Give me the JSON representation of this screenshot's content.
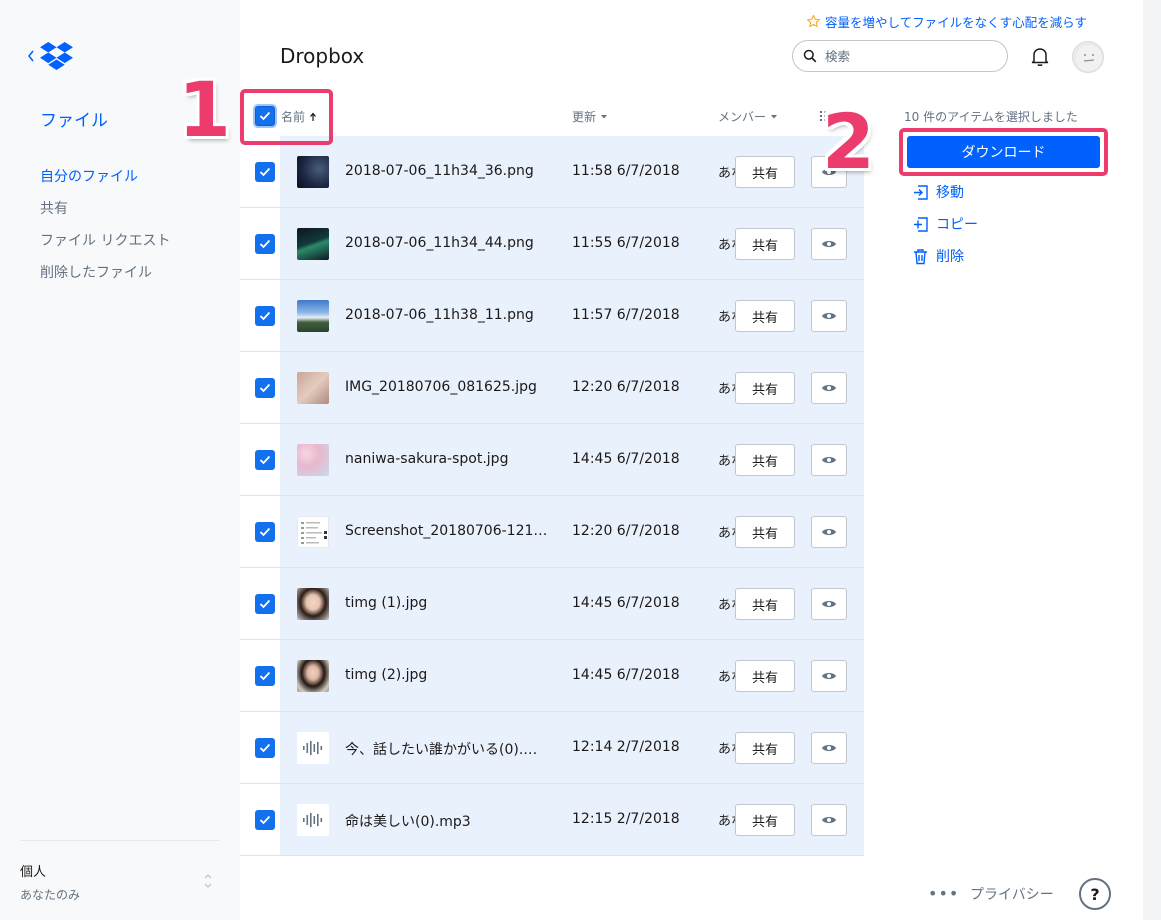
{
  "banner": {
    "upgrade_text": "容量を増やしてファイルをなくす心配を減らす"
  },
  "sidebar": {
    "section_title": "ファイル",
    "items": [
      {
        "label": "自分のファイル",
        "active": true
      },
      {
        "label": "共有",
        "active": false
      },
      {
        "label": "ファイル リクエスト",
        "active": false
      },
      {
        "label": "削除したファイル",
        "active": false
      }
    ],
    "account": {
      "type": "個人",
      "subtitle": "あなたのみ"
    }
  },
  "header": {
    "title": "Dropbox",
    "search_placeholder": "検索"
  },
  "table": {
    "columns": {
      "name": "名前",
      "modified": "更新",
      "members": "メンバー"
    },
    "rows": [
      {
        "name": "2018-07-06_11h34_36.png",
        "modified": "11:58 6/7/2018",
        "members": "あなたのみ",
        "share": "共有",
        "thumb": "space-dark"
      },
      {
        "name": "2018-07-06_11h34_44.png",
        "modified": "11:55 6/7/2018",
        "members": "あなたのみ",
        "share": "共有",
        "thumb": "aurora"
      },
      {
        "name": "2018-07-06_11h38_11.png",
        "modified": "11:57 6/7/2018",
        "members": "あなたのみ",
        "share": "共有",
        "thumb": "mountain"
      },
      {
        "name": "IMG_20180706_081625.jpg",
        "modified": "12:20 6/7/2018",
        "members": "あなたのみ",
        "share": "共有",
        "thumb": "skin"
      },
      {
        "name": "naniwa-sakura-spot.jpg",
        "modified": "14:45 6/7/2018",
        "members": "あなたのみ",
        "share": "共有",
        "thumb": "sakura"
      },
      {
        "name": "Screenshot_20180706-12164...",
        "modified": "12:20 6/7/2018",
        "members": "あなたのみ",
        "share": "共有",
        "thumb": "screenshot"
      },
      {
        "name": "timg (1).jpg",
        "modified": "14:45 6/7/2018",
        "members": "あなたのみ",
        "share": "共有",
        "thumb": "portrait-1"
      },
      {
        "name": "timg (2).jpg",
        "modified": "14:45 6/7/2018",
        "members": "あなたのみ",
        "share": "共有",
        "thumb": "portrait-2"
      },
      {
        "name": "今、話したい誰かがいる(0).m...",
        "modified": "12:14 2/7/2018",
        "members": "あなたのみ",
        "share": "共有",
        "thumb": "audio"
      },
      {
        "name": "命は美しい(0).mp3",
        "modified": "12:15 2/7/2018",
        "members": "あなたのみ",
        "share": "共有",
        "thumb": "audio"
      }
    ]
  },
  "panel": {
    "selection_text": "10 件のアイテムを選択しました",
    "download_label": "ダウンロード",
    "move_label": "移動",
    "copy_label": "コピー",
    "delete_label": "削除"
  },
  "footer": {
    "more": "•••",
    "privacy": "プライバシー",
    "help": "?"
  },
  "annotations": {
    "step1": "1",
    "step2": "2"
  },
  "colors": {
    "accent": "#0061fe",
    "annotation": "#ec3b6d",
    "selected_row": "#e9f1fc"
  }
}
